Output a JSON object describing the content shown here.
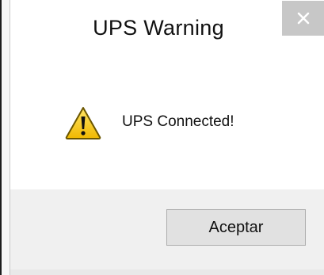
{
  "window": {
    "title": "UPS Warning",
    "close_icon": "close-icon"
  },
  "message": {
    "icon": "warning-icon",
    "text": "UPS Connected!"
  },
  "buttons": {
    "ok_label": "Aceptar"
  },
  "colors": {
    "warning_fill": "#f2c200",
    "warning_outline": "#5a4a00",
    "close_button_bg": "#c7c7c7",
    "footer_bg": "#f0f0f0"
  }
}
